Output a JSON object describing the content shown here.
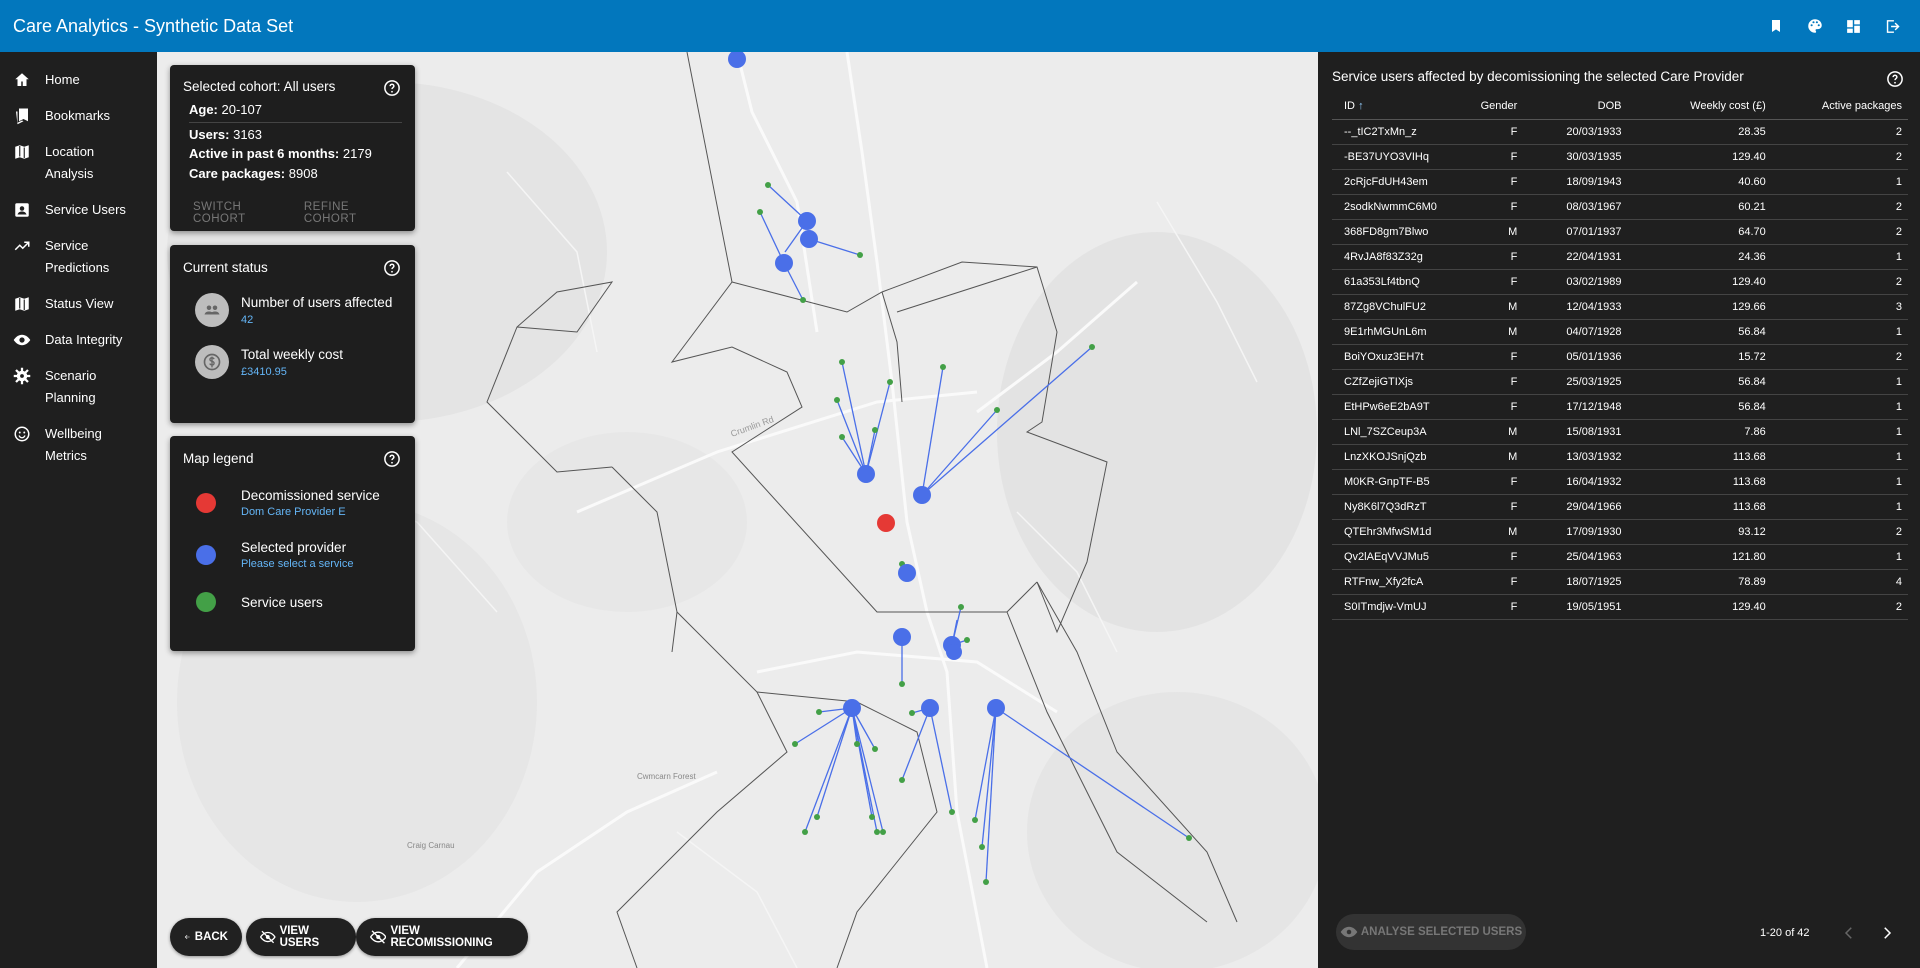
{
  "app": {
    "title": "Care Analytics - Synthetic Data Set"
  },
  "sidebar": {
    "items": [
      {
        "label": "Home",
        "icon": "home-icon"
      },
      {
        "label": "Bookmarks",
        "icon": "bookmarks-icon"
      },
      {
        "label": "Location Analysis",
        "icon": "map-icon"
      },
      {
        "label": "Service Users",
        "icon": "account-box-icon"
      },
      {
        "label": "Service Predictions",
        "icon": "trending-up-icon"
      },
      {
        "label": "Status View",
        "icon": "map-icon"
      },
      {
        "label": "Data Integrity",
        "icon": "eye-icon"
      },
      {
        "label": "Scenario Planning",
        "icon": "settings-icon"
      },
      {
        "label": "Wellbeing Metrics",
        "icon": "smiley-icon"
      }
    ]
  },
  "cohort": {
    "title": "Selected cohort: All users",
    "age_key": "Age:",
    "age": "20-107",
    "users_key": "Users:",
    "users": "3163",
    "active_key": "Active in past 6 months:",
    "active": "2179",
    "packages_key": "Care packages:",
    "packages": "8908",
    "switch_label": "SWITCH COHORT",
    "refine_label": "REFINE COHORT"
  },
  "status": {
    "title": "Current status",
    "users_label": "Number of users affected",
    "users_value": "42",
    "cost_label": "Total weekly cost",
    "cost_value": "£3410.95"
  },
  "legend": {
    "title": "Map legend",
    "decom_label": "Decomissioned service",
    "decom_sub": "Dom Care Provider E",
    "decom_color": "#e53935",
    "selected_label": "Selected provider",
    "selected_sub": "Please select a service",
    "selected_color": "#4a6fe8",
    "users_label": "Service users",
    "users_color": "#43a047"
  },
  "map": {
    "labels": {
      "road": "Crumlin Rd",
      "forest": "Cwmcarn Forest",
      "place": "Craig Carnau"
    }
  },
  "actions": {
    "back": "BACK",
    "view_users": "VIEW USERS",
    "view_recommissioning": "VIEW RECOMISSIONING"
  },
  "panel": {
    "title": "Service users affected by decomissioning the selected Care Provider",
    "columns": {
      "id": "ID",
      "gender": "Gender",
      "dob": "DOB",
      "cost": "Weekly cost (£)",
      "packages": "Active packages"
    },
    "rows": [
      {
        "id": "--_tIC2TxMn_z",
        "gender": "F",
        "dob": "20/03/1933",
        "cost": "28.35",
        "packages": "2"
      },
      {
        "id": "-BE37UYO3VIHq",
        "gender": "F",
        "dob": "30/03/1935",
        "cost": "129.40",
        "packages": "2"
      },
      {
        "id": "2cRjcFdUH43em",
        "gender": "F",
        "dob": "18/09/1943",
        "cost": "40.60",
        "packages": "1"
      },
      {
        "id": "2sodkNwmmC6M0",
        "gender": "F",
        "dob": "08/03/1967",
        "cost": "60.21",
        "packages": "2"
      },
      {
        "id": "368FD8gm7Blwo",
        "gender": "M",
        "dob": "07/01/1937",
        "cost": "64.70",
        "packages": "2"
      },
      {
        "id": "4RvJA8f83Z32g",
        "gender": "F",
        "dob": "22/04/1931",
        "cost": "24.36",
        "packages": "1"
      },
      {
        "id": "61a353Lf4tbnQ",
        "gender": "F",
        "dob": "03/02/1989",
        "cost": "129.40",
        "packages": "2"
      },
      {
        "id": "87Zg8VChulFU2",
        "gender": "M",
        "dob": "12/04/1933",
        "cost": "129.66",
        "packages": "3"
      },
      {
        "id": "9E1rhMGUnL6m",
        "gender": "M",
        "dob": "04/07/1928",
        "cost": "56.84",
        "packages": "1"
      },
      {
        "id": "BoiYOxuz3EH7t",
        "gender": "F",
        "dob": "05/01/1936",
        "cost": "15.72",
        "packages": "2"
      },
      {
        "id": "CZfZejiGTIXjs",
        "gender": "F",
        "dob": "25/03/1925",
        "cost": "56.84",
        "packages": "1"
      },
      {
        "id": "EtHPw6eE2bA9T",
        "gender": "F",
        "dob": "17/12/1948",
        "cost": "56.84",
        "packages": "1"
      },
      {
        "id": "LNl_7SZCeup3A",
        "gender": "M",
        "dob": "15/08/1931",
        "cost": "7.86",
        "packages": "1"
      },
      {
        "id": "LnzXKOJSnjQzb",
        "gender": "M",
        "dob": "13/03/1932",
        "cost": "113.68",
        "packages": "1"
      },
      {
        "id": "M0KR-GnpTF-B5",
        "gender": "F",
        "dob": "16/04/1932",
        "cost": "113.68",
        "packages": "1"
      },
      {
        "id": "Ny8K6l7Q3dRzT",
        "gender": "F",
        "dob": "29/04/1966",
        "cost": "113.68",
        "packages": "1"
      },
      {
        "id": "QTEhr3MfwSM1d",
        "gender": "M",
        "dob": "17/09/1930",
        "cost": "93.12",
        "packages": "2"
      },
      {
        "id": "Qv2lAEqVVJMu5",
        "gender": "F",
        "dob": "25/04/1963",
        "cost": "121.80",
        "packages": "1"
      },
      {
        "id": "RTFnw_Xfy2fcA",
        "gender": "F",
        "dob": "18/07/1925",
        "cost": "78.89",
        "packages": "4"
      },
      {
        "id": "S0ITmdjw-VmUJ",
        "gender": "F",
        "dob": "19/05/1951",
        "cost": "129.40",
        "packages": "2"
      }
    ],
    "analyse_label": "ANALYSE SELECTED USERS",
    "pager_range": "1-20 of 42"
  }
}
